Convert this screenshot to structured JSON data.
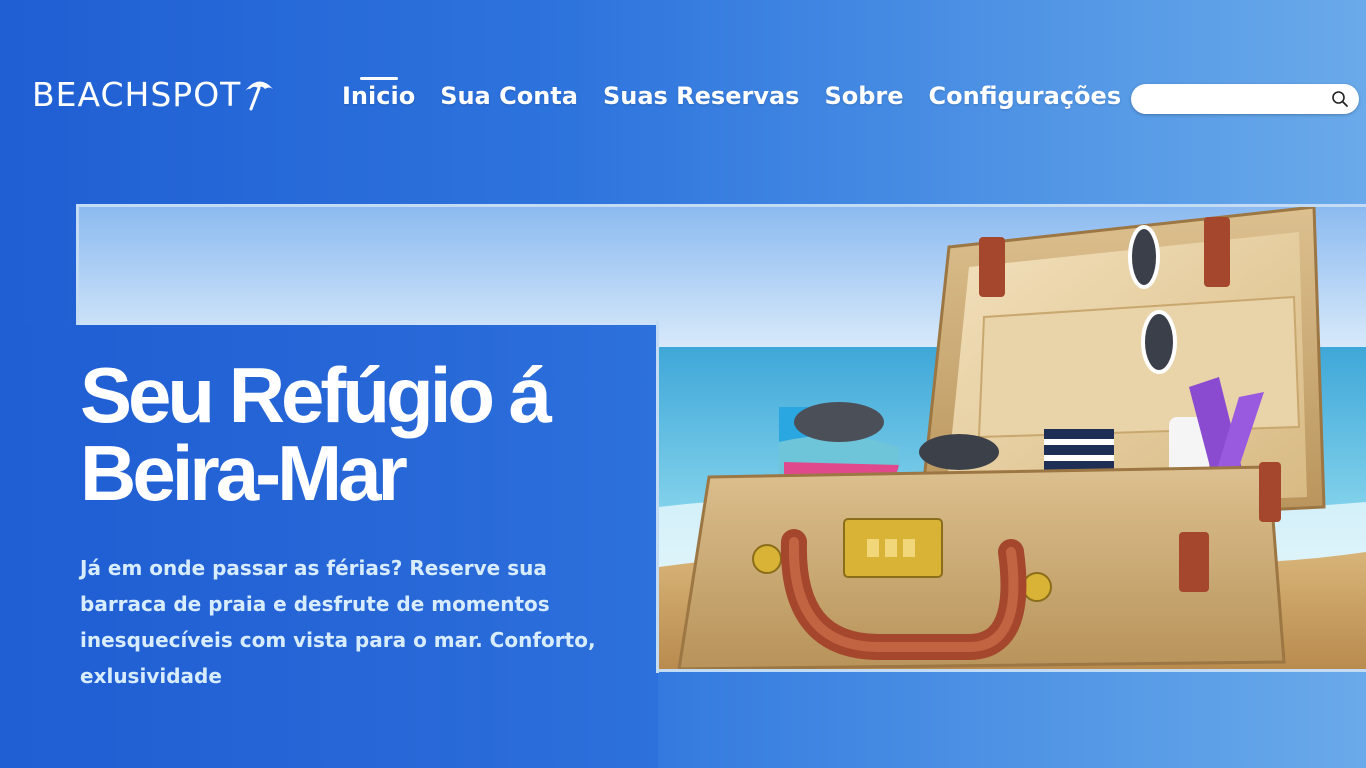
{
  "brand": {
    "logo_text": "BEACHSPOT",
    "logo_icon": "beach-umbrella-icon"
  },
  "nav": {
    "items": [
      {
        "label": "Inicio",
        "active": true
      },
      {
        "label": "Sua Conta",
        "active": false
      },
      {
        "label": "Suas Reservas",
        "active": false
      },
      {
        "label": "Sobre",
        "active": false
      },
      {
        "label": "Configurações",
        "active": false
      }
    ]
  },
  "search": {
    "placeholder": "",
    "value": "",
    "icon": "search-icon"
  },
  "hero": {
    "title": "Seu Refúgio á Beira-Mar",
    "description": "Já em onde passar as férias? Reserve sua barraca de praia e desfrute de momentos inesquecíveis com vista para o mar. Conforto, exlusividade",
    "image_icon": "open-suitcase-on-beach-image"
  },
  "colors": {
    "background_start": "#1f5ed3",
    "background_end": "#6aaaea",
    "frame_border": "#c4dbf4",
    "text": "#ffffff",
    "description_text": "#d8ecff"
  }
}
